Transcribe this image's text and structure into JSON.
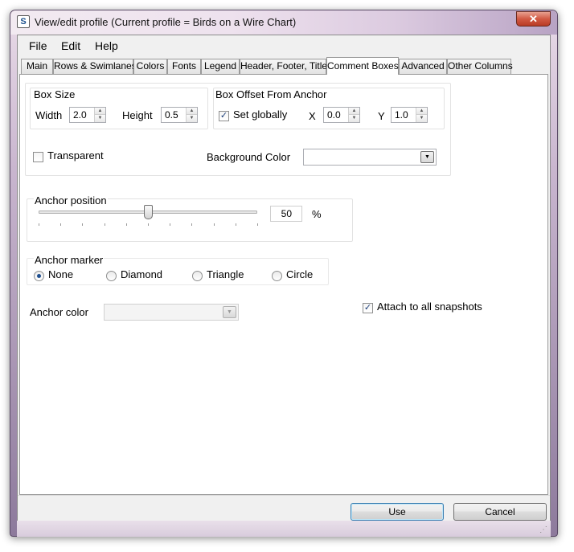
{
  "window": {
    "title": "View/edit profile (Current profile = Birds on a Wire Chart)",
    "close_glyph": "✕"
  },
  "menu": [
    {
      "label": "File"
    },
    {
      "label": "Edit"
    },
    {
      "label": "Help"
    }
  ],
  "tabs": [
    {
      "label": "Main"
    },
    {
      "label": "Rows & Swimlanes"
    },
    {
      "label": "Colors"
    },
    {
      "label": "Fonts"
    },
    {
      "label": "Legend"
    },
    {
      "label": "Header, Footer, Title"
    },
    {
      "label": "Comment Boxes",
      "active": true
    },
    {
      "label": "Advanced"
    },
    {
      "label": "Other Columns"
    }
  ],
  "box_size": {
    "title": "Box Size",
    "width_label": "Width",
    "width_value": "2.0",
    "height_label": "Height",
    "height_value": "0.5"
  },
  "box_offset": {
    "title": "Box Offset From Anchor",
    "set_globally_label": "Set globally",
    "set_globally_checked": true,
    "x_label": "X",
    "x_value": "0.0",
    "y_label": "Y",
    "y_value": "1.0"
  },
  "transparent": {
    "label": "Transparent",
    "checked": false
  },
  "background_color": {
    "label": "Background Color",
    "value": ""
  },
  "anchor_position": {
    "title": "Anchor position",
    "value": "50",
    "unit": "%",
    "slider_fraction": 0.5
  },
  "anchor_marker": {
    "title": "Anchor marker",
    "options": [
      {
        "label": "None",
        "selected": true
      },
      {
        "label": "Diamond",
        "selected": false
      },
      {
        "label": "Triangle",
        "selected": false
      },
      {
        "label": "Circle",
        "selected": false
      }
    ]
  },
  "anchor_color": {
    "label": "Anchor color",
    "value": ""
  },
  "attach_snapshots": {
    "label": "Attach to all snapshots",
    "checked": true
  },
  "buttons": {
    "use": "Use",
    "cancel": "Cancel"
  },
  "icons": {
    "app": "app-icon",
    "spin_up": "▲",
    "spin_down": "▼",
    "dropdown": "▼",
    "check": "✓",
    "grip": "⋰"
  }
}
